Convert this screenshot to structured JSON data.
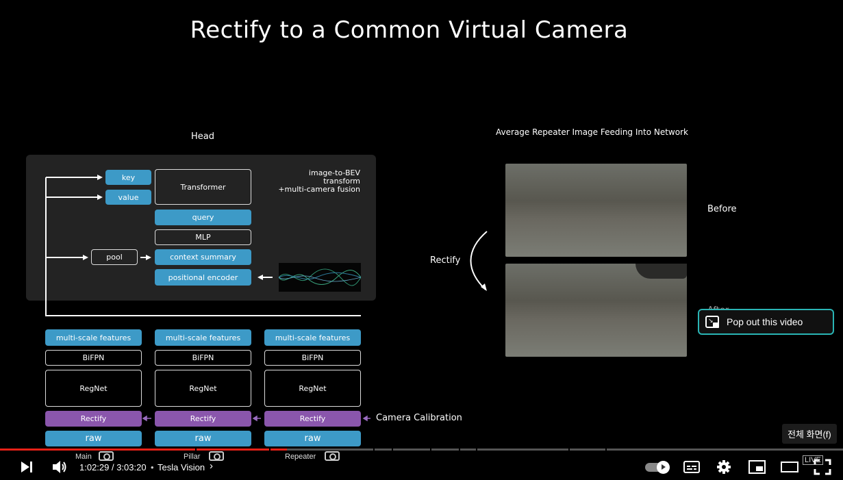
{
  "slide": {
    "title": "Rectify to a Common Virtual Camera",
    "head_title": "Head",
    "panel_note_1": "image-to-BEV transform",
    "panel_note_2": "+multi-camera fusion",
    "nodes": {
      "key": "key",
      "value": "value",
      "transformer": "Transformer",
      "query": "query",
      "mlp": "MLP",
      "pool": "pool",
      "context_summary": "context summary",
      "positional_encoder": "positional encoder"
    },
    "columns": [
      {
        "features": "multi-scale features",
        "bifpn": "BiFPN",
        "regnet": "RegNet",
        "rectify": "Rectify",
        "raw": "raw"
      },
      {
        "features": "multi-scale features",
        "bifpn": "BiFPN",
        "regnet": "RegNet",
        "rectify": "Rectify",
        "raw": "raw"
      },
      {
        "features": "multi-scale features",
        "bifpn": "BiFPN",
        "regnet": "RegNet",
        "rectify": "Rectify",
        "raw": "raw"
      }
    ],
    "camera_calibration": "Camera Calibration",
    "right_title": "Average Repeater Image Feeding Into Network",
    "before": "Before",
    "after": "After",
    "rectify_label": "Rectify"
  },
  "overlay": {
    "popout": "Pop out this video",
    "fullscreen_tooltip": "전체 화면(f)"
  },
  "player": {
    "time": "1:02:29 / 3:03:20",
    "separator": "•",
    "chapter": "Tesla Vision",
    "chapter_labels": [
      "Main",
      "Pillar",
      "Repeater"
    ],
    "progress": 0.34,
    "buffered": 0.01,
    "live": "LIVE",
    "accent": "#e62117"
  }
}
